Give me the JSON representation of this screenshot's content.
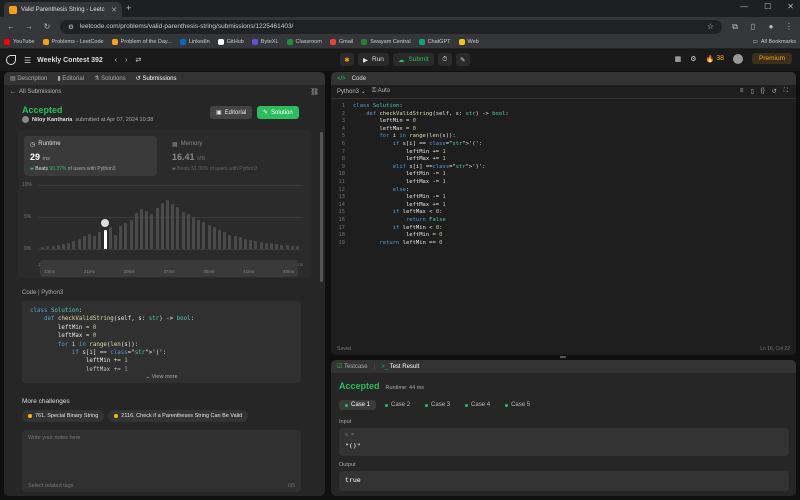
{
  "browser": {
    "tab_title": "Valid Parenthesis String - Leetc",
    "url": "leetcode.com/problems/valid-parenthesis-string/submissions/1225461403/",
    "bookmarks": [
      "YouTube",
      "Problems - LeetCode",
      "Problem of the Day...",
      "LinkedIn",
      "GitHub",
      "ByteXL",
      "Classroom",
      "Gmail",
      "Swayam Central",
      "ChatGPT",
      "Web"
    ],
    "all_bookmarks": "All Bookmarks",
    "bookmark_colors": [
      "#ff0000",
      "#f89f1b",
      "#f89f1b",
      "#0a66c2",
      "#ffffff",
      "#6b4bd8",
      "#1e8e3e",
      "#ea4335",
      "#2e7d32",
      "#10a37f",
      "#f5c518"
    ]
  },
  "nav": {
    "contest": "Weekly Contest 392",
    "run": "Run",
    "submit": "Submit",
    "streak": "38",
    "premium": "Premium"
  },
  "left": {
    "tabs": [
      "Description",
      "Editorial",
      "Solutions",
      "Submissions"
    ],
    "back": "All Submissions",
    "status": "Accepted",
    "user": "Niloy Kantharia",
    "submitted": "submitted at Apr 07, 2024 10:38",
    "editorial_btn": "Editorial",
    "solution_btn": "Solution",
    "runtime": {
      "label": "Runtime",
      "value": "29",
      "unit": "ms",
      "beats_pct": "90.37%",
      "beats_prefix": "Beats",
      "beats_suffix": "of users with Python3"
    },
    "memory": {
      "label": "Memory",
      "value": "16.41",
      "unit": "MB",
      "beats_pct": "51.00%",
      "beats_prefix": "Beats",
      "beats_suffix": "of users with Python3"
    },
    "chart_y": [
      "10%",
      "5%",
      "0%"
    ],
    "chart_x": [
      "13ms",
      "23ms",
      "30ms",
      "37ms",
      "38ms",
      "41ms",
      "48ms"
    ],
    "chart_x2": [
      "13ms",
      "21ms",
      "29ms",
      "37ms",
      "45ms",
      "41ms",
      "49ms"
    ],
    "code_label": "Code",
    "code_lang": "Python3",
    "view_more": "View more",
    "more_challenges": "More challenges",
    "challenges": [
      "761. Special Binary String",
      "2116. Check if a Parentheses String Can Be Valid"
    ],
    "notes_placeholder": "Write your notes here",
    "tags_placeholder": "Select related tags",
    "notes_count": "0/5"
  },
  "chart_data": {
    "type": "bar",
    "title": "",
    "xlabel": "",
    "ylabel": "",
    "ylim": [
      0,
      10
    ],
    "x_ticks": [
      "13ms",
      "23ms",
      "30ms",
      "37ms",
      "38ms",
      "41ms",
      "48ms"
    ],
    "y_ticks": [
      "10%",
      "5%",
      "0%"
    ],
    "values": [
      0.3,
      0.4,
      0.5,
      0.6,
      0.8,
      1.0,
      1.3,
      1.6,
      2.0,
      2.4,
      2.0,
      2.6,
      3.0,
      3.4,
      2.2,
      3.6,
      4.0,
      4.6,
      5.6,
      6.2,
      6.0,
      5.4,
      6.4,
      7.2,
      7.6,
      7.0,
      6.6,
      5.8,
      5.4,
      5.0,
      4.6,
      4.2,
      3.8,
      3.4,
      3.0,
      2.6,
      2.2,
      2.0,
      1.8,
      1.6,
      1.4,
      1.2,
      1.1,
      1.0,
      0.9,
      0.8,
      0.7,
      0.6,
      0.5,
      0.4
    ],
    "highlight_index": 12,
    "highlight_color": "#ffffff",
    "bar_color": "#4a4a4a",
    "grid": true
  },
  "editor": {
    "title": "Code",
    "lang": "Python3",
    "auto": "Auto",
    "saved": "Saved",
    "position": "Ln 16, Col 22",
    "lines": [
      "class Solution:",
      "    def checkValidString(self, s: str) -> bool:",
      "        leftMin = 0",
      "        leftMax = 0",
      "        for i in range(len(s)):",
      "            if s[i] == '(':",
      "                leftMin += 1",
      "                leftMax += 1",
      "            elif s[i] ==')':",
      "                leftMin -= 1",
      "                leftMax -= 1",
      "            else:",
      "                leftMin -= 1",
      "                leftMax += 1",
      "            if leftMax < 0:",
      "                return False",
      "            if leftMin < 0:",
      "                leftMin = 0",
      "        return leftMin == 0"
    ],
    "preview_lines": [
      "class Solution:",
      "    def checkValidString(self, s: str) -> bool:",
      "        leftMin = 0",
      "        leftMax = 0",
      "        for i in range(len(s)):",
      "            if s[i] == '(':",
      "                leftMin += 1",
      "                leftMax += 1"
    ]
  },
  "result": {
    "testcase_tab": "Testcase",
    "result_tab": "Test Result",
    "status": "Accepted",
    "runtime": "Runtime: 44 ms",
    "cases": [
      "Case 1",
      "Case 2",
      "Case 3",
      "Case 4",
      "Case 5"
    ],
    "input_label": "Input",
    "input_var": "s =",
    "input_value": "\"()\"",
    "output_label": "Output",
    "output_value": "true"
  }
}
